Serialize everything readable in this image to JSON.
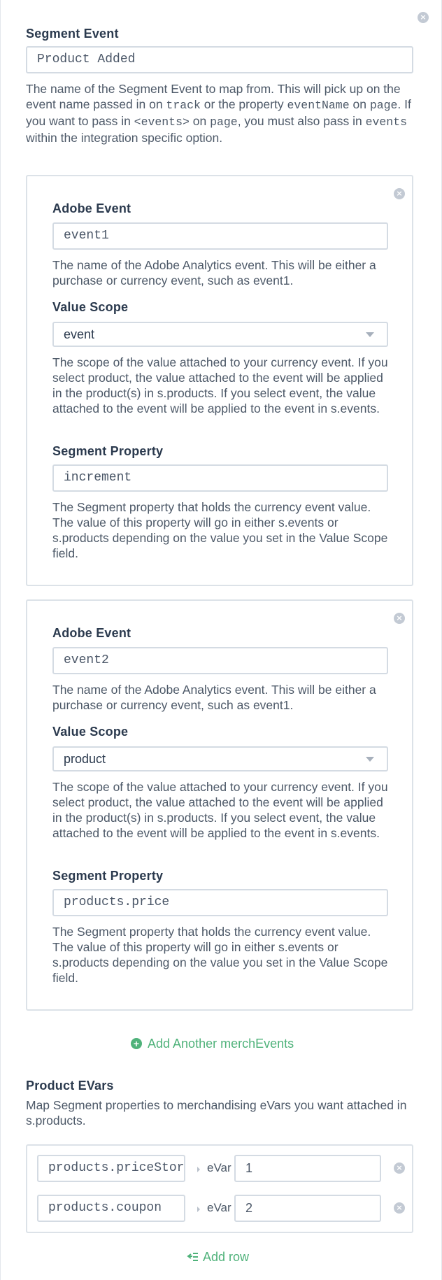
{
  "segment_event": {
    "label": "Segment Event",
    "value": "Product Added",
    "help_parts": [
      "The name of the Segment Event to map from. This will pick up on the event name passed in on ",
      "track",
      " or the property ",
      "eventName",
      " on ",
      "page",
      ". If you want to pass in ",
      "<events>",
      " on ",
      "page",
      ", you must also pass in ",
      "events",
      " within the integration specific option."
    ]
  },
  "merch_events": [
    {
      "adobe_event_label": "Adobe Event",
      "adobe_event_value": "event1",
      "adobe_event_help": "The name of the Adobe Analytics event. This will be either a purchase or currency event, such as event1.",
      "value_scope_label": "Value Scope",
      "value_scope_selected": "event",
      "value_scope_help": "The scope of the value attached to your currency event. If you select product, the value attached to the event will be applied in the product(s) in s.products. If you select event, the value attached to the event will be applied to the event in s.events.",
      "segment_property_label": "Segment Property",
      "segment_property_value": "increment",
      "segment_property_help": "The Segment property that holds the currency event value. The value of this property will go in either s.events or s.products depending on the value you set in the Value Scope field."
    },
    {
      "adobe_event_label": "Adobe Event",
      "adobe_event_value": "event2",
      "adobe_event_help": "The name of the Adobe Analytics event. This will be either a purchase or currency event, such as event1.",
      "value_scope_label": "Value Scope",
      "value_scope_selected": "product",
      "value_scope_help": "The scope of the value attached to your currency event. If you select product, the value attached to the event will be applied in the product(s) in s.products. If you select event, the value attached to the event will be applied to the event in s.events.",
      "segment_property_label": "Segment Property",
      "segment_property_value": "products.price",
      "segment_property_help": "The Segment property that holds the currency event value. The value of this property will go in either s.events or s.products depending on the value you set in the Value Scope field."
    }
  ],
  "add_merch_events_label": "Add Another merchEvents",
  "product_evars": {
    "label": "Product EVars",
    "help": "Map Segment properties to merchandising eVars you want attached in s.products.",
    "rows": [
      {
        "property": "products.priceStoreCurrency",
        "evar_label": "eVar",
        "evar_value": "1"
      },
      {
        "property": "products.coupon",
        "evar_label": "eVar",
        "evar_value": "2"
      }
    ],
    "add_row_label": "Add row"
  },
  "icons": {
    "close": "close-circle-icon",
    "add": "plus-circle-icon",
    "dropdown": "chevron-down-icon",
    "add_row": "list-add-icon"
  },
  "colors": {
    "accent_green": "#4fb27a",
    "border": "#d4dbe3",
    "text": "#2b3a4e"
  }
}
